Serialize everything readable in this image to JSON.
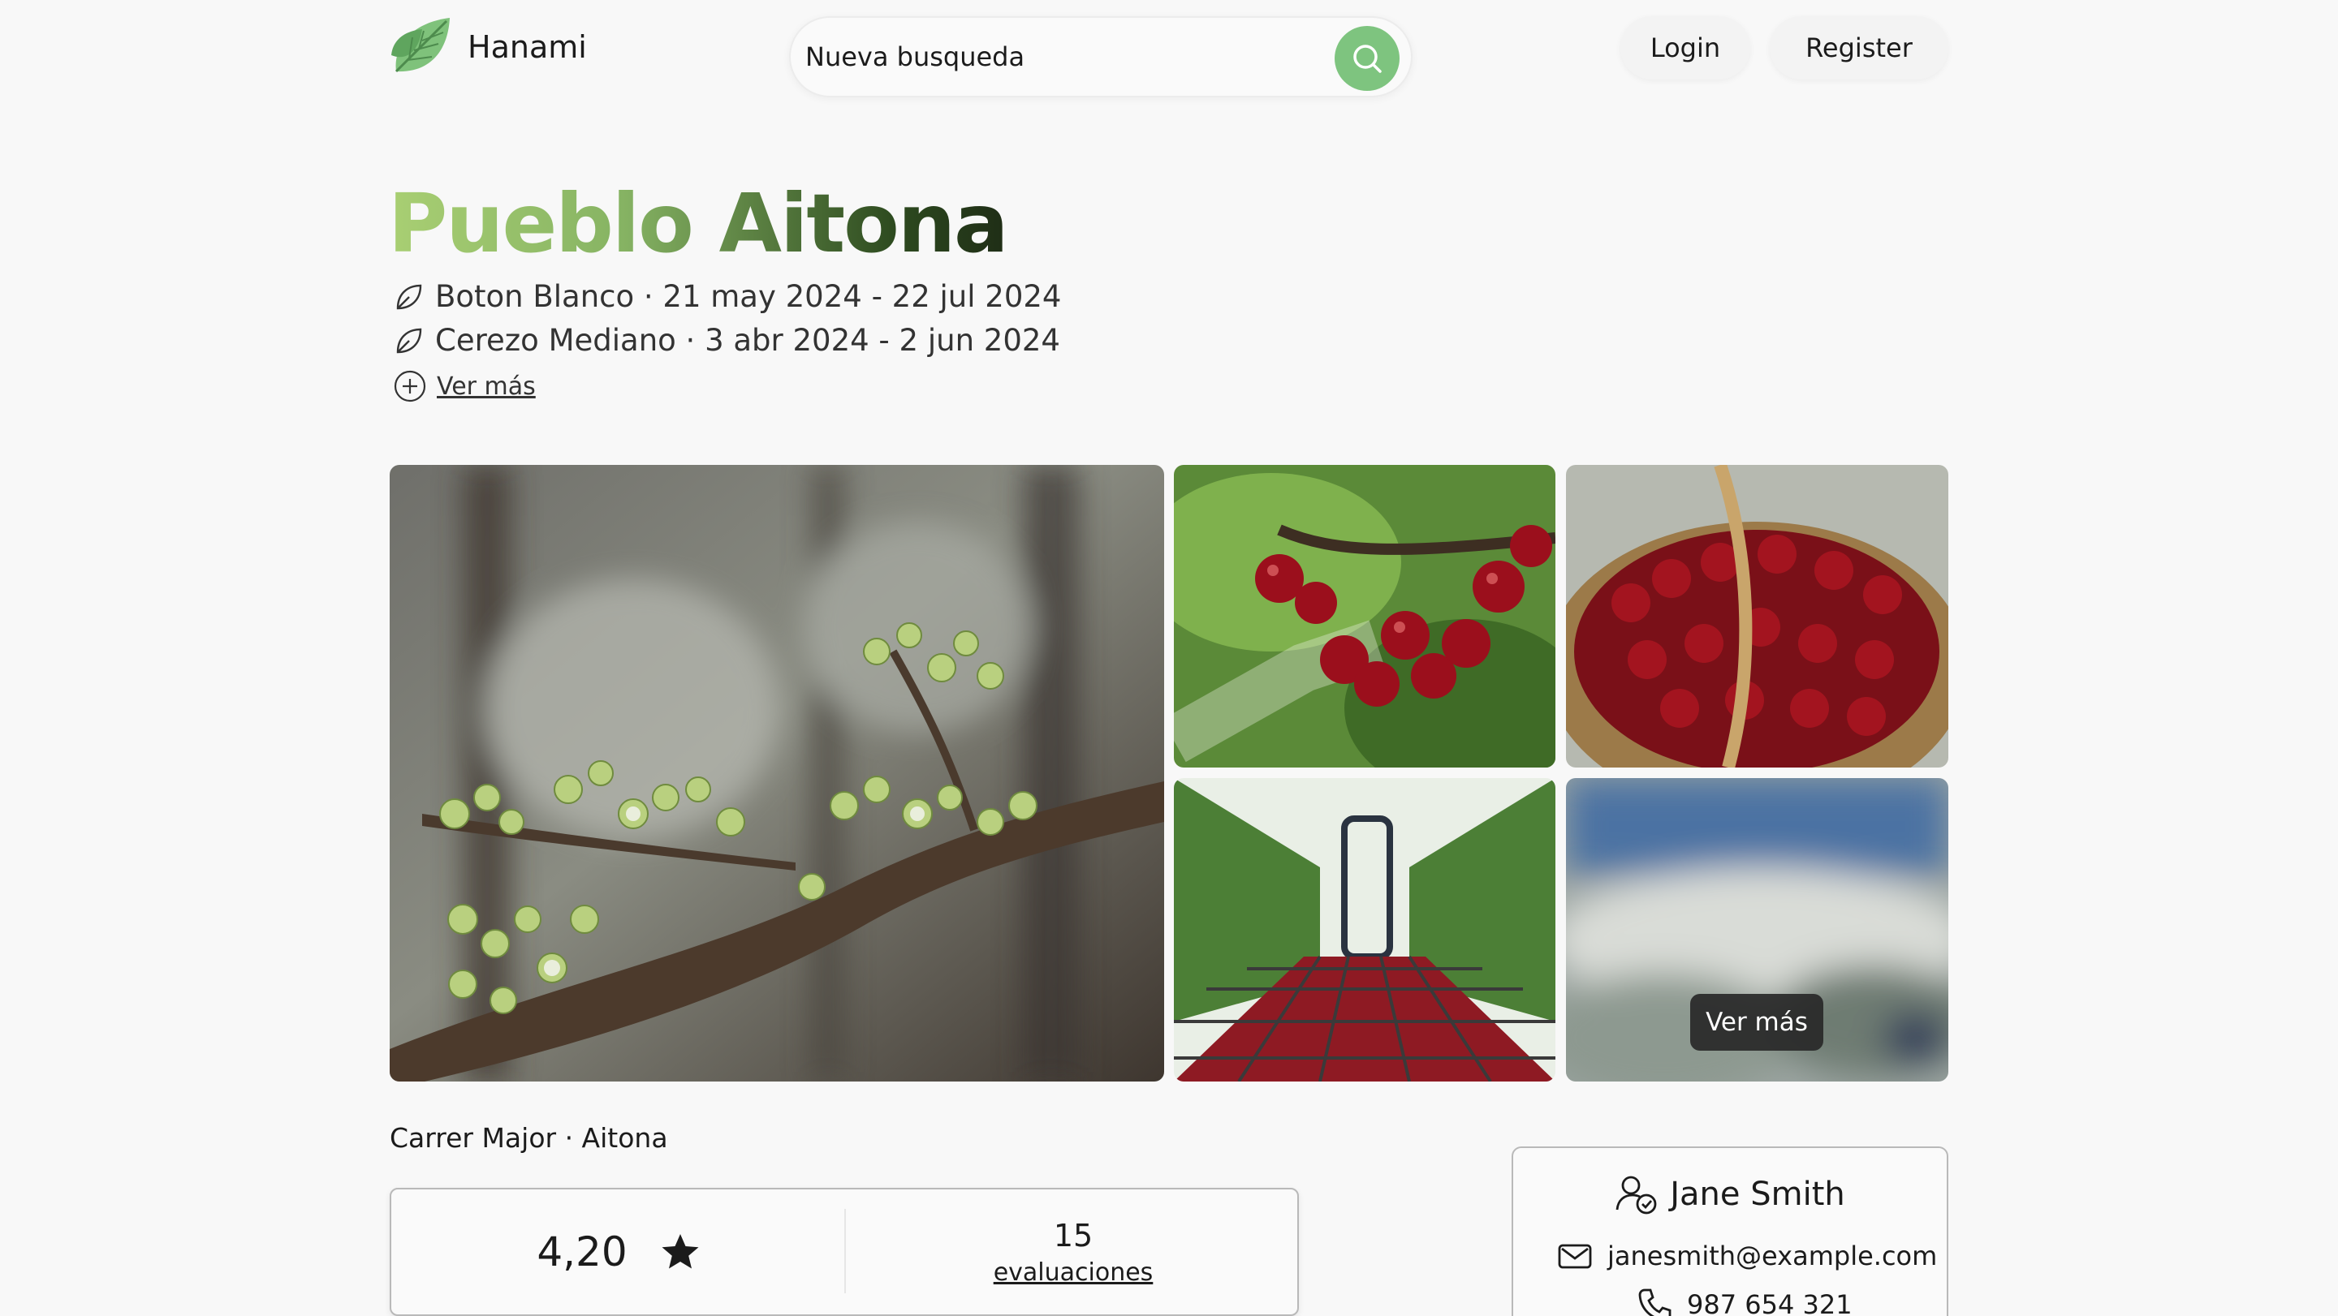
{
  "header": {
    "brand": "Hanami",
    "search_value": "Nueva busqueda",
    "login_label": "Login",
    "register_label": "Register"
  },
  "place": {
    "title": "Pueblo Aitona",
    "seasons": [
      "Boton Blanco · 21 may 2024 - 22 jul 2024",
      "Cerezo Mediano · 3 abr 2024 - 2 jun 2024"
    ],
    "see_more_label": "Ver más"
  },
  "gallery": {
    "see_more_label": "Ver más",
    "photos": [
      "cherry-blossom-buds-photo",
      "cherries-on-tree-photo",
      "cherry-basket-photo",
      "cherry-harvest-crates-photo",
      "blurred-landscape-photo"
    ]
  },
  "details": {
    "address": "Carrer Major · Aitona",
    "rating": "4,20",
    "review_count": "15",
    "review_link": "evaluaciones"
  },
  "owner": {
    "name": "Jane Smith",
    "email": "janesmith@example.com",
    "phone": "987 654 321"
  },
  "colors": {
    "accent_green": "#7ec47f",
    "title_gradient_start": "#a9cf73",
    "title_gradient_end": "#1f2d16"
  }
}
